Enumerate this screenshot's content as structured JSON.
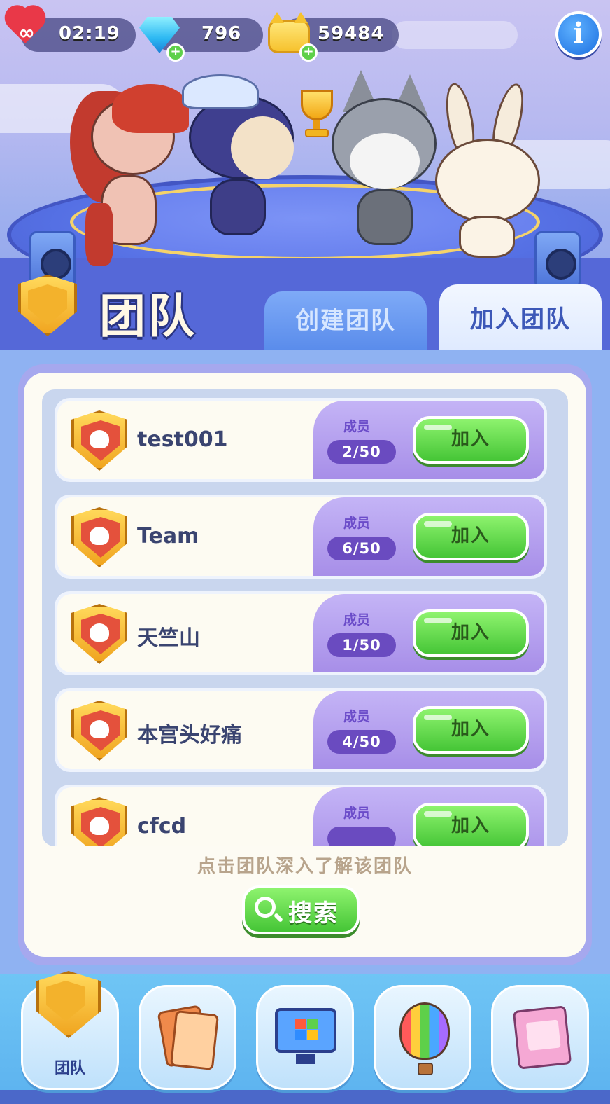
{
  "hud": {
    "lives_symbol": "∞",
    "timer": "02:19",
    "gems": "796",
    "coins": "59484",
    "plus_symbol": "+",
    "info_symbol": "i"
  },
  "header": {
    "title": "团队",
    "tabs": [
      {
        "label": "创建团队",
        "active": false
      },
      {
        "label": "加入团队",
        "active": true
      }
    ]
  },
  "team_list": {
    "members_label": "成员",
    "join_label": "加入",
    "teams": [
      {
        "name": "test001",
        "members": "2/50"
      },
      {
        "name": "Team",
        "members": "6/50"
      },
      {
        "name": "天竺山",
        "members": "1/50"
      },
      {
        "name": "本宫头好痛",
        "members": "4/50"
      },
      {
        "name": "cfcd",
        "members": ""
      }
    ]
  },
  "hint": "点击团队深入了解该团队",
  "search": {
    "label": "搜索",
    "icon": "search-icon"
  },
  "bottom_nav": {
    "items": [
      {
        "label": "团队",
        "icon": "team-shield-icon",
        "active": true
      },
      {
        "label": "",
        "icon": "cards-icon",
        "active": false
      },
      {
        "label": "",
        "icon": "monitor-icon",
        "active": false
      },
      {
        "label": "",
        "icon": "hot-air-balloon-icon",
        "active": false
      },
      {
        "label": "",
        "icon": "photo-album-icon",
        "active": false
      }
    ]
  },
  "colors": {
    "accent_green": "#45c536",
    "member_purple": "#6a4bc0",
    "title_navy": "#2a3582",
    "tab_active_text": "#3d58b8"
  }
}
